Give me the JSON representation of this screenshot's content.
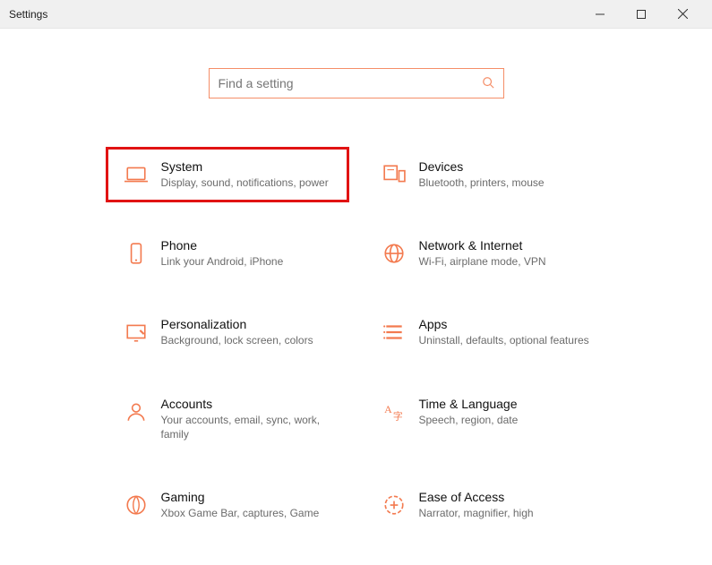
{
  "window": {
    "title": "Settings"
  },
  "search": {
    "placeholder": "Find a setting"
  },
  "tiles": [
    {
      "title": "System",
      "sub": "Display, sound, notifications, power",
      "name": "settings-tile-system",
      "icon": "laptop-icon",
      "highlight": true
    },
    {
      "title": "Devices",
      "sub": "Bluetooth, printers, mouse",
      "name": "settings-tile-devices",
      "icon": "devices-icon",
      "highlight": false
    },
    {
      "title": "Phone",
      "sub": "Link your Android, iPhone",
      "name": "settings-tile-phone",
      "icon": "phone-icon",
      "highlight": false
    },
    {
      "title": "Network & Internet",
      "sub": "Wi-Fi, airplane mode, VPN",
      "name": "settings-tile-network",
      "icon": "globe-icon",
      "highlight": false
    },
    {
      "title": "Personalization",
      "sub": "Background, lock screen, colors",
      "name": "settings-tile-personalization",
      "icon": "personalize-icon",
      "highlight": false
    },
    {
      "title": "Apps",
      "sub": "Uninstall, defaults, optional features",
      "name": "settings-tile-apps",
      "icon": "apps-icon",
      "highlight": false
    },
    {
      "title": "Accounts",
      "sub": "Your accounts, email, sync, work, family",
      "name": "settings-tile-accounts",
      "icon": "accounts-icon",
      "highlight": false
    },
    {
      "title": "Time & Language",
      "sub": "Speech, region, date",
      "name": "settings-tile-time-language",
      "icon": "time-lang-icon",
      "highlight": false
    },
    {
      "title": "Gaming",
      "sub": "Xbox Game Bar, captures, Game",
      "name": "settings-tile-gaming",
      "icon": "gaming-icon",
      "highlight": false
    },
    {
      "title": "Ease of Access",
      "sub": "Narrator, magnifier, high",
      "name": "settings-tile-ease-of-access",
      "icon": "ease-icon",
      "highlight": false
    }
  ]
}
